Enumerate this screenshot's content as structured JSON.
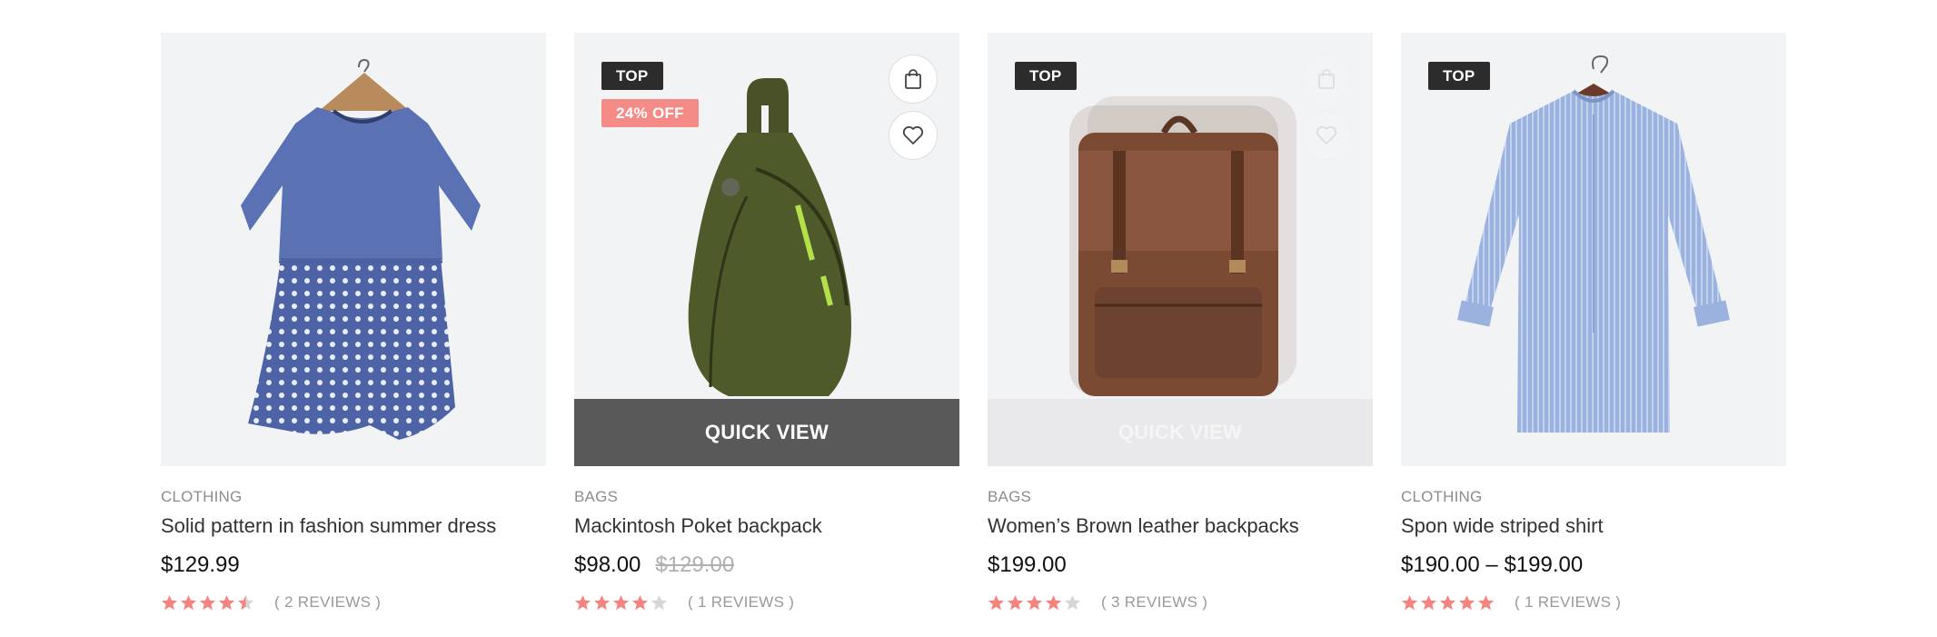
{
  "colors": {
    "badge_dark": "#2c2c2c",
    "badge_sale": "#f58b87",
    "star_filled": "#f4847f",
    "star_empty": "#d6d6d6",
    "quickview_bg": "#595959"
  },
  "products": [
    {
      "category": "CLOTHING",
      "title": "Solid pattern in fashion summer dress",
      "price": "$129.99",
      "old_price": "",
      "rating": 4.5,
      "reviews": "( 2 REVIEWS )",
      "badge": "",
      "discount": ""
    },
    {
      "category": "BAGS",
      "title": "Mackintosh Poket backpack",
      "price": "$98.00",
      "old_price": "$129.00",
      "rating": 4,
      "reviews": "( 1 REVIEWS )",
      "badge": "TOP",
      "discount": "24% OFF",
      "quick_view": "QUICK VIEW",
      "icons": [
        "shopping-bag-icon",
        "heart-icon"
      ]
    },
    {
      "category": "BAGS",
      "title": "Women’s Brown leather backpacks",
      "price": "$199.00",
      "old_price": "",
      "rating": 4,
      "reviews": "( 3 REVIEWS )",
      "badge": "TOP",
      "discount": "",
      "quick_view": "QUICK VIEW"
    },
    {
      "category": "CLOTHING",
      "title": "Spon wide striped shirt",
      "price": "$190.00 – $199.00",
      "old_price": "",
      "rating": 5,
      "reviews": "( 1 REVIEWS )",
      "badge": "TOP",
      "discount": ""
    }
  ]
}
